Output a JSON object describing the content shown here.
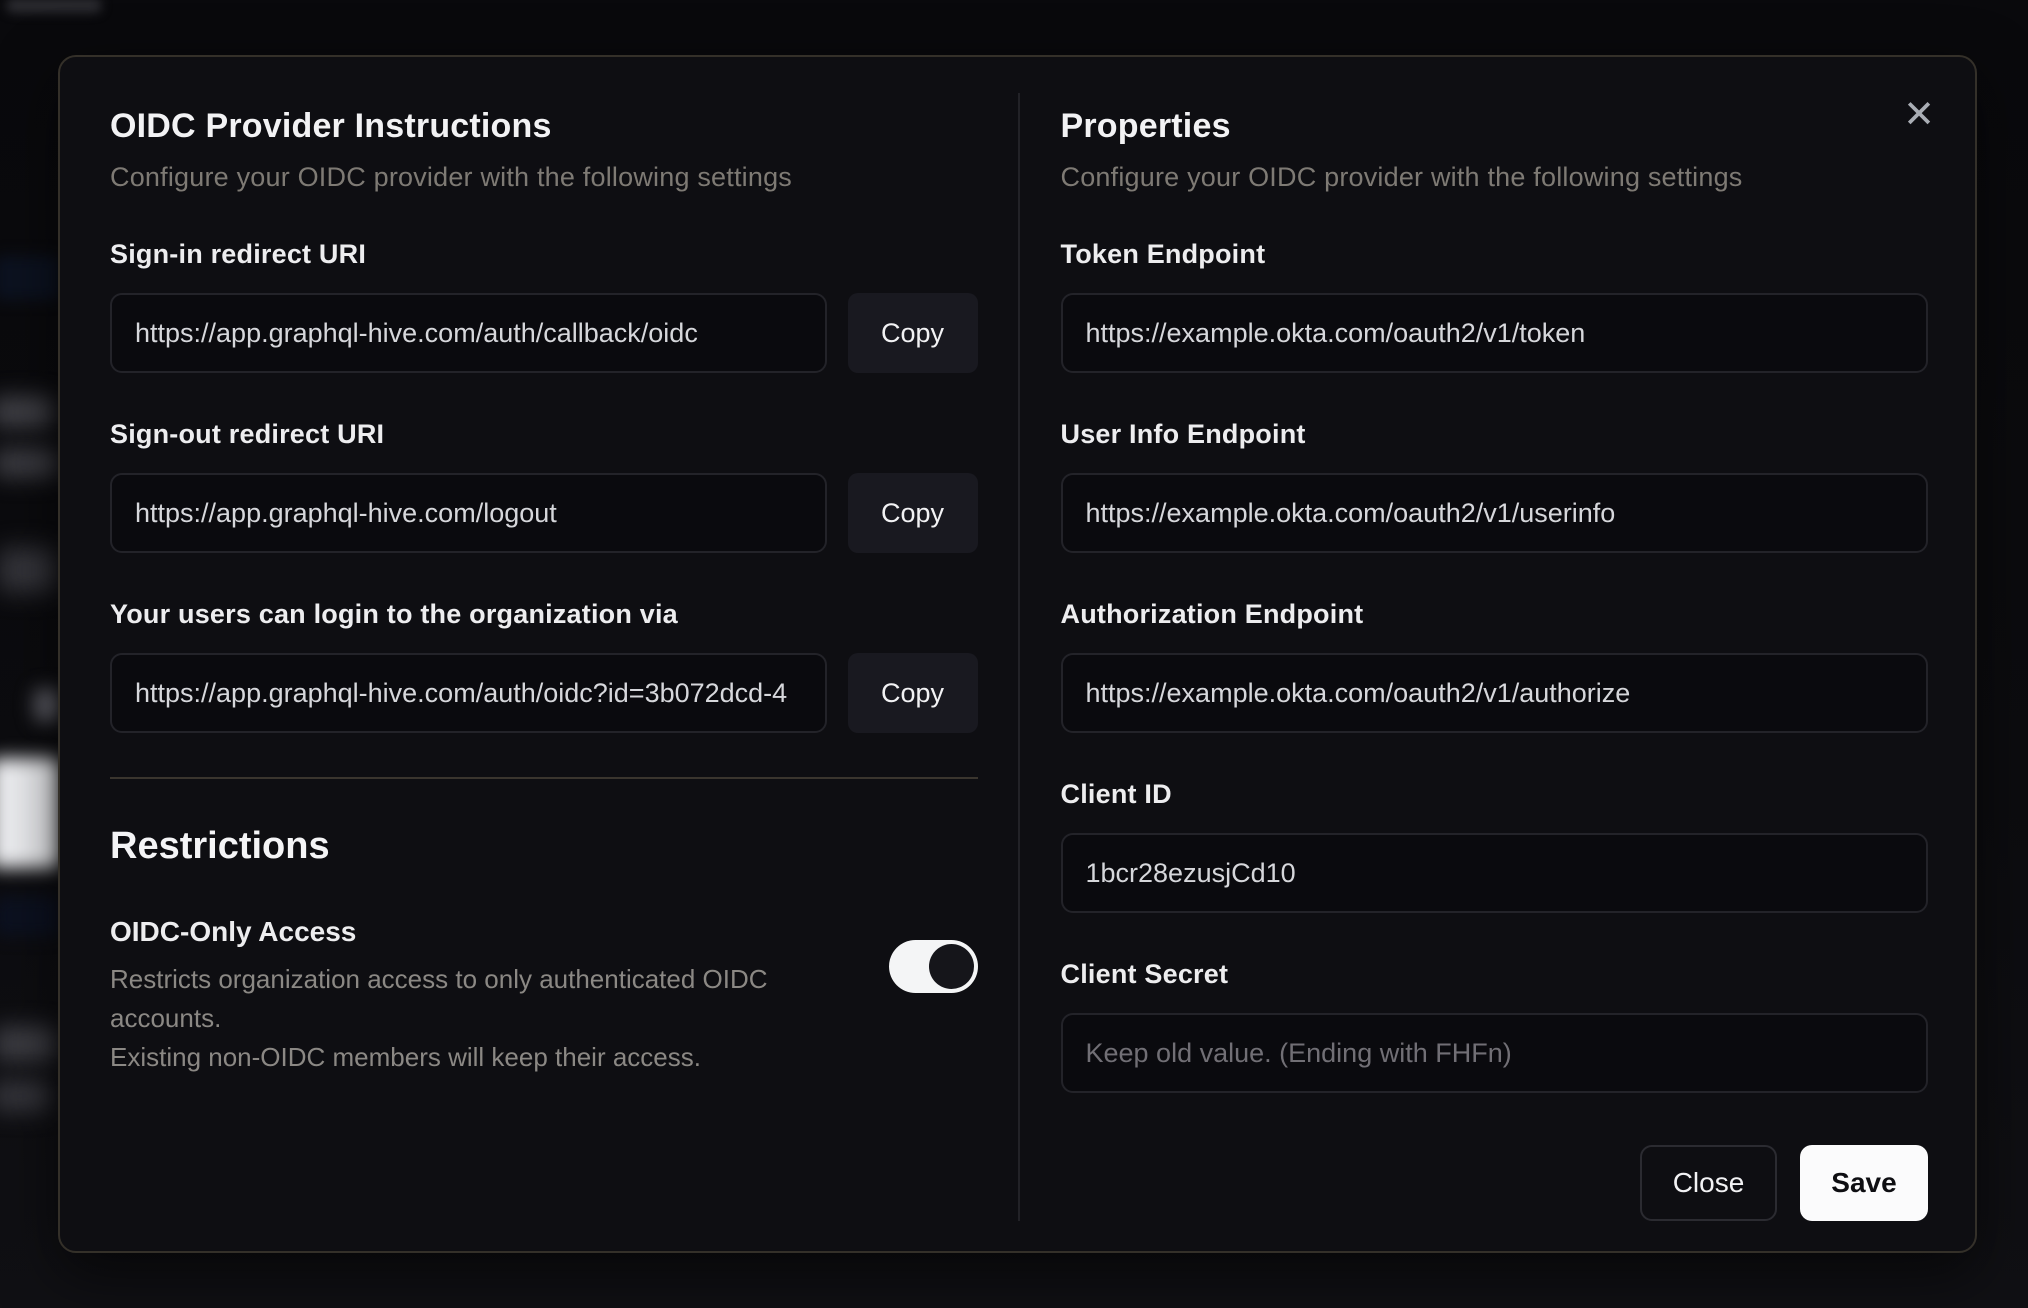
{
  "modal": {
    "close_icon_glyph": "✕",
    "left": {
      "title": "OIDC Provider Instructions",
      "subtitle": "Configure your OIDC provider with the following settings",
      "fields": [
        {
          "label": "Sign-in redirect URI",
          "value": "https://app.graphql-hive.com/auth/callback/oidc",
          "copy_label": "Copy"
        },
        {
          "label": "Sign-out redirect URI",
          "value": "https://app.graphql-hive.com/logout",
          "copy_label": "Copy"
        },
        {
          "label": "Your users can login to the organization via",
          "value": "https://app.graphql-hive.com/auth/oidc?id=3b072dcd-4",
          "copy_label": "Copy"
        }
      ],
      "restrictions": {
        "title": "Restrictions",
        "toggle_label": "OIDC-Only Access",
        "toggle_description_line1": "Restricts organization access to only authenticated OIDC accounts.",
        "toggle_description_line2": "Existing non-OIDC members will keep their access.",
        "toggle_state": "on"
      }
    },
    "right": {
      "title": "Properties",
      "subtitle": "Configure your OIDC provider with the following settings",
      "fields": [
        {
          "label": "Token Endpoint",
          "value": "https://example.okta.com/oauth2/v1/token"
        },
        {
          "label": "User Info Endpoint",
          "value": "https://example.okta.com/oauth2/v1/userinfo"
        },
        {
          "label": "Authorization Endpoint",
          "value": "https://example.okta.com/oauth2/v1/authorize"
        },
        {
          "label": "Client ID",
          "value": "1bcr28ezusjCd10"
        },
        {
          "label": "Client Secret",
          "value": "",
          "placeholder": "Keep old value. (Ending with FHFn)"
        }
      ],
      "footer": {
        "close_label": "Close",
        "save_label": "Save"
      }
    }
  },
  "colors": {
    "modal_background": "#0e0e12",
    "input_background": "#0a0a0e",
    "accent_save": "#fbfbfc",
    "toggle_on_track": "#f4f5f6",
    "heading_text": "#f2f2f4",
    "muted_text": "#7e7a74"
  }
}
